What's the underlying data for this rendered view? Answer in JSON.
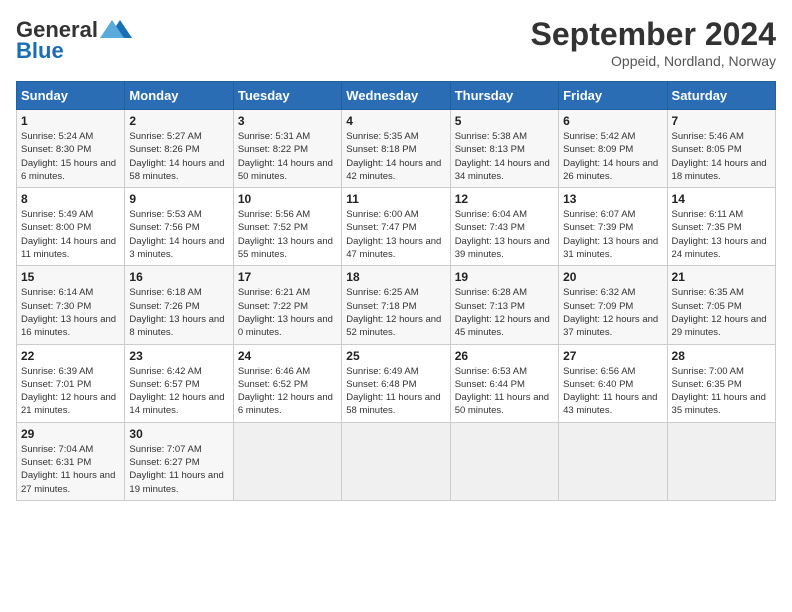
{
  "header": {
    "logo_general": "General",
    "logo_blue": "Blue",
    "month": "September 2024",
    "location": "Oppeid, Nordland, Norway"
  },
  "days_of_week": [
    "Sunday",
    "Monday",
    "Tuesday",
    "Wednesday",
    "Thursday",
    "Friday",
    "Saturday"
  ],
  "weeks": [
    [
      {
        "day": "1",
        "sunrise": "Sunrise: 5:24 AM",
        "sunset": "Sunset: 8:30 PM",
        "daylight": "Daylight: 15 hours and 6 minutes."
      },
      {
        "day": "2",
        "sunrise": "Sunrise: 5:27 AM",
        "sunset": "Sunset: 8:26 PM",
        "daylight": "Daylight: 14 hours and 58 minutes."
      },
      {
        "day": "3",
        "sunrise": "Sunrise: 5:31 AM",
        "sunset": "Sunset: 8:22 PM",
        "daylight": "Daylight: 14 hours and 50 minutes."
      },
      {
        "day": "4",
        "sunrise": "Sunrise: 5:35 AM",
        "sunset": "Sunset: 8:18 PM",
        "daylight": "Daylight: 14 hours and 42 minutes."
      },
      {
        "day": "5",
        "sunrise": "Sunrise: 5:38 AM",
        "sunset": "Sunset: 8:13 PM",
        "daylight": "Daylight: 14 hours and 34 minutes."
      },
      {
        "day": "6",
        "sunrise": "Sunrise: 5:42 AM",
        "sunset": "Sunset: 8:09 PM",
        "daylight": "Daylight: 14 hours and 26 minutes."
      },
      {
        "day": "7",
        "sunrise": "Sunrise: 5:46 AM",
        "sunset": "Sunset: 8:05 PM",
        "daylight": "Daylight: 14 hours and 18 minutes."
      }
    ],
    [
      {
        "day": "8",
        "sunrise": "Sunrise: 5:49 AM",
        "sunset": "Sunset: 8:00 PM",
        "daylight": "Daylight: 14 hours and 11 minutes."
      },
      {
        "day": "9",
        "sunrise": "Sunrise: 5:53 AM",
        "sunset": "Sunset: 7:56 PM",
        "daylight": "Daylight: 14 hours and 3 minutes."
      },
      {
        "day": "10",
        "sunrise": "Sunrise: 5:56 AM",
        "sunset": "Sunset: 7:52 PM",
        "daylight": "Daylight: 13 hours and 55 minutes."
      },
      {
        "day": "11",
        "sunrise": "Sunrise: 6:00 AM",
        "sunset": "Sunset: 7:47 PM",
        "daylight": "Daylight: 13 hours and 47 minutes."
      },
      {
        "day": "12",
        "sunrise": "Sunrise: 6:04 AM",
        "sunset": "Sunset: 7:43 PM",
        "daylight": "Daylight: 13 hours and 39 minutes."
      },
      {
        "day": "13",
        "sunrise": "Sunrise: 6:07 AM",
        "sunset": "Sunset: 7:39 PM",
        "daylight": "Daylight: 13 hours and 31 minutes."
      },
      {
        "day": "14",
        "sunrise": "Sunrise: 6:11 AM",
        "sunset": "Sunset: 7:35 PM",
        "daylight": "Daylight: 13 hours and 24 minutes."
      }
    ],
    [
      {
        "day": "15",
        "sunrise": "Sunrise: 6:14 AM",
        "sunset": "Sunset: 7:30 PM",
        "daylight": "Daylight: 13 hours and 16 minutes."
      },
      {
        "day": "16",
        "sunrise": "Sunrise: 6:18 AM",
        "sunset": "Sunset: 7:26 PM",
        "daylight": "Daylight: 13 hours and 8 minutes."
      },
      {
        "day": "17",
        "sunrise": "Sunrise: 6:21 AM",
        "sunset": "Sunset: 7:22 PM",
        "daylight": "Daylight: 13 hours and 0 minutes."
      },
      {
        "day": "18",
        "sunrise": "Sunrise: 6:25 AM",
        "sunset": "Sunset: 7:18 PM",
        "daylight": "Daylight: 12 hours and 52 minutes."
      },
      {
        "day": "19",
        "sunrise": "Sunrise: 6:28 AM",
        "sunset": "Sunset: 7:13 PM",
        "daylight": "Daylight: 12 hours and 45 minutes."
      },
      {
        "day": "20",
        "sunrise": "Sunrise: 6:32 AM",
        "sunset": "Sunset: 7:09 PM",
        "daylight": "Daylight: 12 hours and 37 minutes."
      },
      {
        "day": "21",
        "sunrise": "Sunrise: 6:35 AM",
        "sunset": "Sunset: 7:05 PM",
        "daylight": "Daylight: 12 hours and 29 minutes."
      }
    ],
    [
      {
        "day": "22",
        "sunrise": "Sunrise: 6:39 AM",
        "sunset": "Sunset: 7:01 PM",
        "daylight": "Daylight: 12 hours and 21 minutes."
      },
      {
        "day": "23",
        "sunrise": "Sunrise: 6:42 AM",
        "sunset": "Sunset: 6:57 PM",
        "daylight": "Daylight: 12 hours and 14 minutes."
      },
      {
        "day": "24",
        "sunrise": "Sunrise: 6:46 AM",
        "sunset": "Sunset: 6:52 PM",
        "daylight": "Daylight: 12 hours and 6 minutes."
      },
      {
        "day": "25",
        "sunrise": "Sunrise: 6:49 AM",
        "sunset": "Sunset: 6:48 PM",
        "daylight": "Daylight: 11 hours and 58 minutes."
      },
      {
        "day": "26",
        "sunrise": "Sunrise: 6:53 AM",
        "sunset": "Sunset: 6:44 PM",
        "daylight": "Daylight: 11 hours and 50 minutes."
      },
      {
        "day": "27",
        "sunrise": "Sunrise: 6:56 AM",
        "sunset": "Sunset: 6:40 PM",
        "daylight": "Daylight: 11 hours and 43 minutes."
      },
      {
        "day": "28",
        "sunrise": "Sunrise: 7:00 AM",
        "sunset": "Sunset: 6:35 PM",
        "daylight": "Daylight: 11 hours and 35 minutes."
      }
    ],
    [
      {
        "day": "29",
        "sunrise": "Sunrise: 7:04 AM",
        "sunset": "Sunset: 6:31 PM",
        "daylight": "Daylight: 11 hours and 27 minutes."
      },
      {
        "day": "30",
        "sunrise": "Sunrise: 7:07 AM",
        "sunset": "Sunset: 6:27 PM",
        "daylight": "Daylight: 11 hours and 19 minutes."
      },
      null,
      null,
      null,
      null,
      null
    ]
  ]
}
